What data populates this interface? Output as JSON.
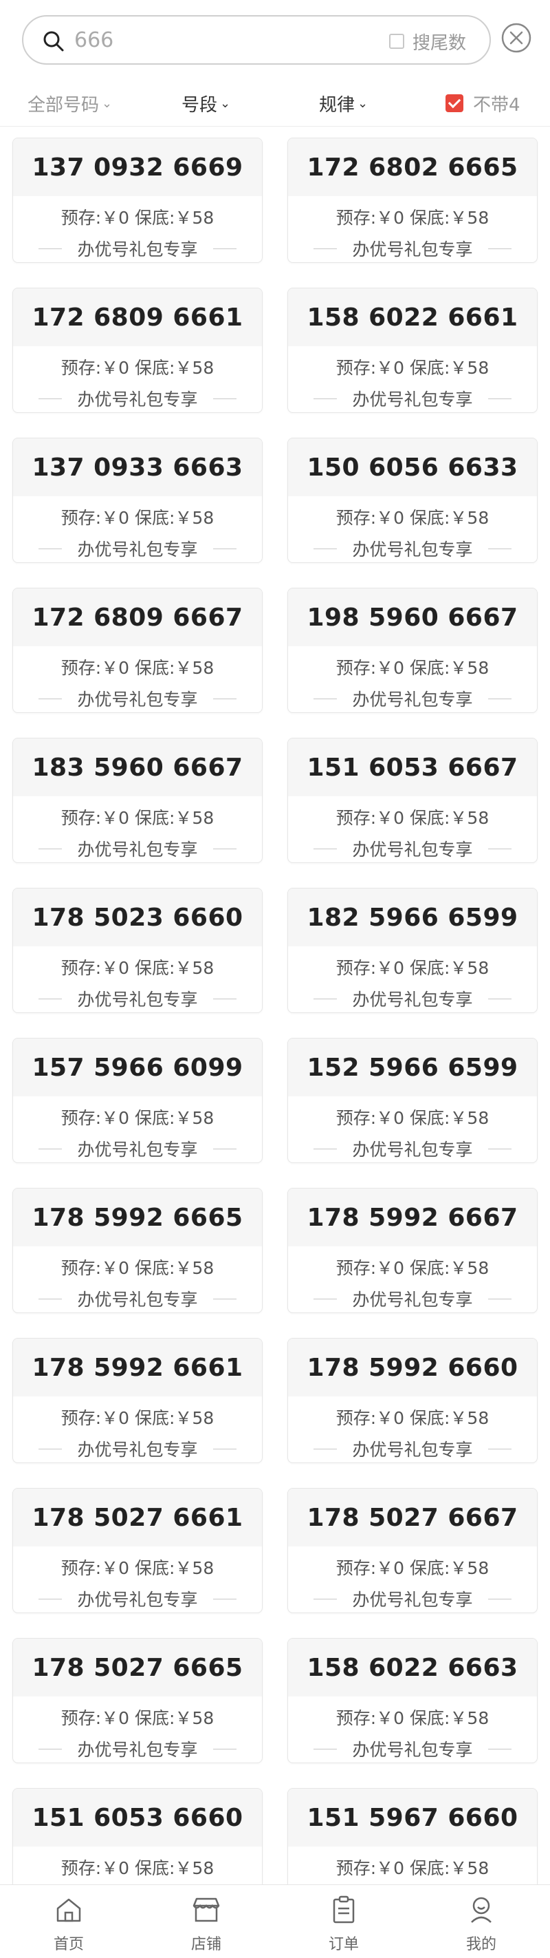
{
  "search": {
    "value": "666",
    "tail_label": "搜尾数"
  },
  "filters": {
    "all": "全部号码",
    "segment": "号段",
    "rule": "规律",
    "no4": "不带4",
    "no4_checked": true
  },
  "card_text": {
    "price": "预存:￥0 保底:￥58",
    "promo": "办优号礼包专享"
  },
  "numbers": [
    "137 0932 6669",
    "172 6802 6665",
    "172 6809 6661",
    "158 6022 6661",
    "137 0933 6663",
    "150 6056 6633",
    "172 6809 6667",
    "198 5960 6667",
    "183 5960 6667",
    "151 6053 6667",
    "178 5023 6660",
    "182 5966 6599",
    "157 5966 6099",
    "152 5966 6599",
    "178 5992 6665",
    "178 5992 6667",
    "178 5992 6661",
    "178 5992 6660",
    "178 5027 6661",
    "178 5027 6667",
    "178 5027 6665",
    "158 6022 6663",
    "151 6053 6660",
    "151 5967 6660"
  ],
  "nav": {
    "home": "首页",
    "shop": "店铺",
    "orders": "订单",
    "mine": "我的"
  },
  "colors": {
    "accent": "#e8463b",
    "card_band": "#f6f6f6"
  }
}
